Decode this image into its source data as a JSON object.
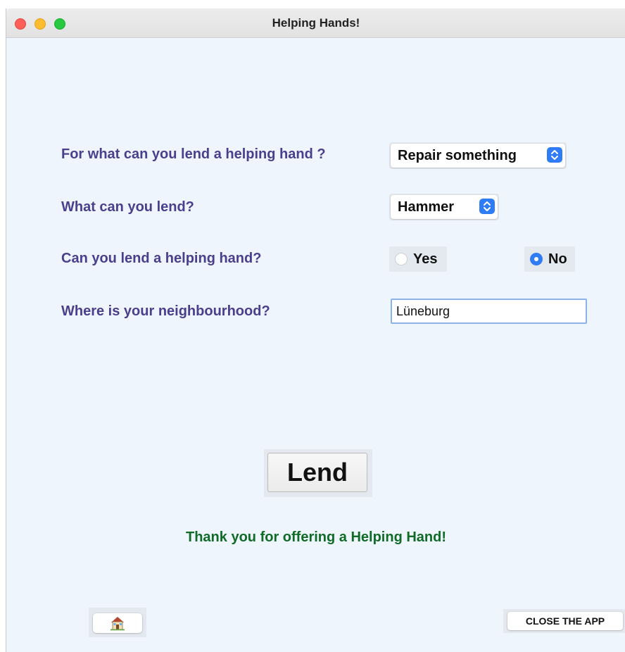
{
  "window": {
    "title": "Helping Hands!"
  },
  "form": {
    "q_help": "For what can you lend a helping hand ?",
    "help_select_value": "Repair something",
    "q_lend": "What can you lend?",
    "lend_select_value": "Hammer",
    "q_can_lend": "Can you lend a helping hand?",
    "radio_yes": "Yes",
    "radio_no": "No",
    "radio_selected": "No",
    "q_neighbourhood": "Where is your neighbourhood?",
    "neighbourhood_value": "Lüneburg"
  },
  "actions": {
    "lend_label": "Lend",
    "thanks_message": "Thank you for offering a Helping Hand!",
    "home_icon": "house-icon",
    "close_label": "CLOSE THE APP"
  },
  "colors": {
    "background": "#eef5fd",
    "label": "#4a3f8c",
    "thanks": "#0f6b25",
    "accent": "#2f7cf6"
  }
}
